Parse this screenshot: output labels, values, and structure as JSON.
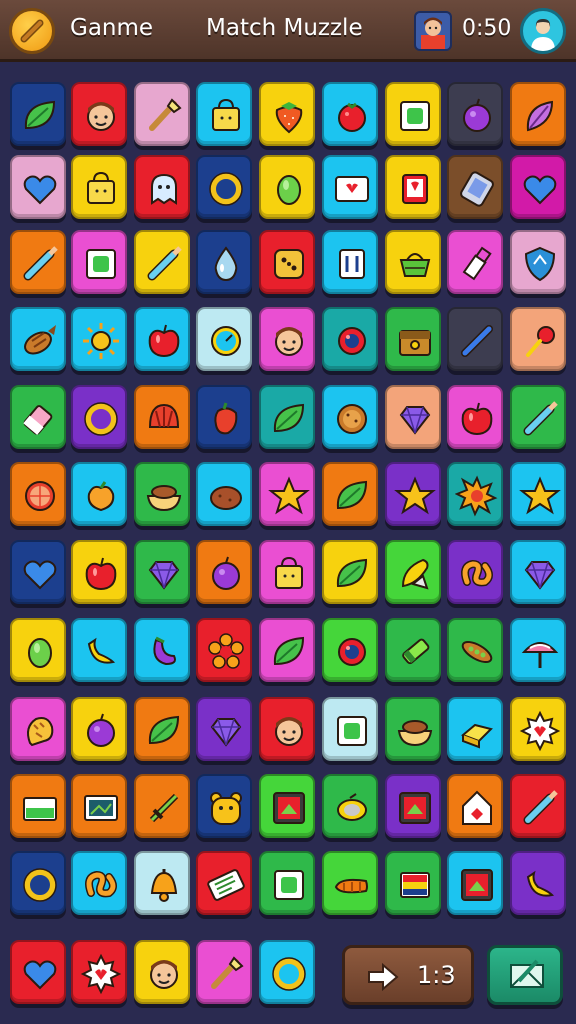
{
  "header": {
    "left_title": "Ganme",
    "center_title": "Match Muzzle",
    "timer": "0:50",
    "menu_icon": "wooden-stick-icon",
    "avatar_icon": "player-avatar-icon",
    "profile_icon": "profile-icon"
  },
  "board": {
    "colors": {
      "red": "#e8202c",
      "orange": "#f07a12",
      "yellow": "#f7d20e",
      "cyan": "#1cc4f0",
      "navy": "#1c3f8e",
      "pink": "#ea4fd2",
      "purple": "#7a30c8",
      "green": "#2fb94a",
      "lightgreen": "#45d63a",
      "teal": "#1aa9a6",
      "brown": "#7b4e2a",
      "grey": "#8b8fa8",
      "lightpink": "#e7a7cf",
      "peach": "#f3a47a",
      "lightcyan": "#bde9f2",
      "darkgrey": "#3d3d50",
      "magenta": "#d21aa8"
    },
    "rows": [
      [
        "navy:leaf-icon",
        "red:face-icon",
        "lightpink:brush-icon",
        "cyan:bag-icon",
        "yellow:strawberry-icon",
        "cyan:berry-icon",
        "yellow:card-icon",
        "darkgrey:plum-icon",
        "orange:feather-icon"
      ],
      [
        "lightpink:heart-icon",
        "yellow:bag-icon",
        "red:ghost-icon",
        "navy:ring-icon",
        "yellow:lime-icon",
        "cyan:envelope-icon",
        "yellow:book-icon",
        "brown:phone-icon",
        "magenta:heart-icon"
      ],
      [
        "orange:pencil-icon",
        "pink:card-icon",
        "yellow:pencil-icon",
        "navy:drop-icon",
        "red:cube-icon",
        "cyan:trash-icon",
        "yellow:basket-icon",
        "pink:lipstick-icon",
        "lightpink:shield-icon"
      ],
      [
        "cyan:fish-icon",
        "cyan:sun-icon",
        "cyan:apple-icon",
        "lightcyan:clock-icon",
        "pink:face-icon",
        "teal:ball-icon",
        "green:chest-icon",
        "darkgrey:pen-icon",
        "peach:rattle-icon"
      ],
      [
        "green:eraser-icon",
        "purple:ring-icon",
        "orange:shell-icon",
        "navy:pepper-icon",
        "teal:leaf-icon",
        "cyan:cookie-icon",
        "peach:gem-icon",
        "pink:apple-icon",
        "green:pencil-icon"
      ],
      [
        "orange:orange-icon",
        "cyan:peach-icon",
        "green:bowl-icon",
        "cyan:potato-icon",
        "pink:star-icon",
        "orange:leaf-icon",
        "purple:star-icon",
        "teal:sunburst-icon",
        "cyan:star-icon"
      ],
      [
        "navy:heart-icon",
        "yellow:apple-icon",
        "green:gem-icon",
        "orange:plum-icon",
        "pink:bag-icon",
        "yellow:leaf-icon",
        "lightgreen:corn-icon",
        "purple:pretzel-icon",
        "cyan:gem-icon"
      ],
      [
        "yellow:lime-icon",
        "cyan:banana-icon",
        "cyan:eggplant-icon",
        "red:flower-icon",
        "pink:leaf-icon",
        "lightgreen:ball-icon",
        "green:crayon-icon",
        "green:pea-icon",
        "cyan:umbrella-icon"
      ],
      [
        "pink:chicken-icon",
        "yellow:plum-icon",
        "orange:leaf-icon",
        "purple:gem-icon",
        "red:face-icon",
        "lightcyan:card-icon",
        "green:bowl-icon",
        "cyan:butter-icon",
        "yellow:badge-icon"
      ],
      [
        "orange:box-icon",
        "orange:board-icon",
        "orange:sword-icon",
        "navy:bear-icon",
        "lightgreen:frame-icon",
        "green:lemon-icon",
        "purple:frame-icon",
        "orange:house-icon",
        "red:pencil-icon"
      ],
      [
        "navy:ring-icon",
        "cyan:pretzel-icon",
        "lightcyan:bell-icon",
        "red:ticket-icon",
        "green:card-icon",
        "lightgreen:carrot-icon",
        "green:flag-icon",
        "cyan:frame-icon",
        "purple:banana-icon"
      ]
    ],
    "bottom_row": [
      "red:heart-icon",
      "red:badge-icon",
      "yellow:face-icon",
      "pink:brush-icon",
      "cyan:ring-icon"
    ]
  },
  "controls": {
    "counter_icon": "arrow-right-icon",
    "counter_value": "1:3",
    "hint_icon": "envelope-icon"
  }
}
